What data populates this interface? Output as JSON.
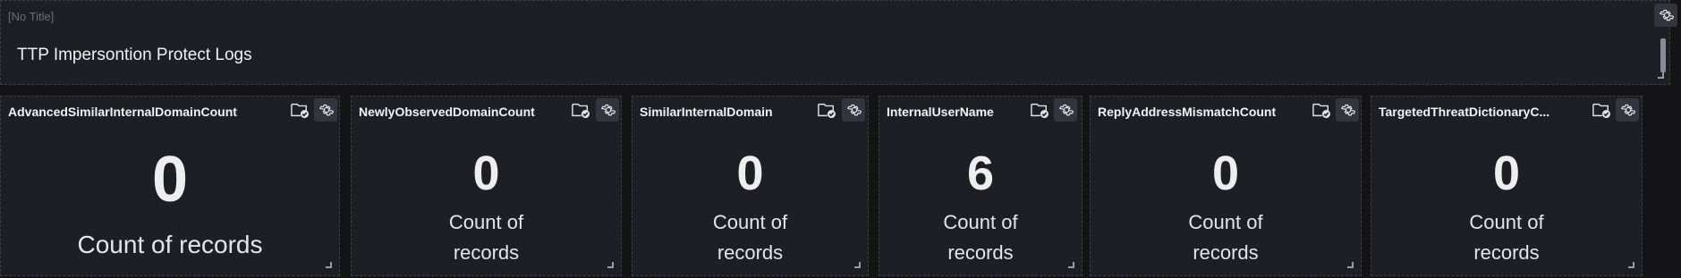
{
  "header": {
    "no_title_label": "[No Title]",
    "title": "TTP Impersontion Protect Logs"
  },
  "icons": {
    "gear": "gear-icon",
    "folder": "folder-check-icon"
  },
  "colors": {
    "background": "#131318",
    "panel": "#1e1e25",
    "text": "#e6e6ea",
    "muted": "#6c6c78",
    "button": "#34343d"
  },
  "cards": [
    {
      "label": "AdvancedSimilarInternalDomainCount",
      "value": "0",
      "subtitle": "Count of records"
    },
    {
      "label": "NewlyObservedDomainCount",
      "value": "0",
      "subtitle_line1": "Count of",
      "subtitle_line2": "records"
    },
    {
      "label": "SimilarInternalDomain",
      "value": "0",
      "subtitle_line1": "Count of",
      "subtitle_line2": "records"
    },
    {
      "label": "InternalUserName",
      "value": "6",
      "subtitle_line1": "Count of",
      "subtitle_line2": "records"
    },
    {
      "label": "ReplyAddressMismatchCount",
      "value": "0",
      "subtitle_line1": "Count of",
      "subtitle_line2": "records"
    },
    {
      "label": "TargetedThreatDictionaryC...",
      "value": "0",
      "subtitle_line1": "Count of",
      "subtitle_line2": "records"
    }
  ]
}
